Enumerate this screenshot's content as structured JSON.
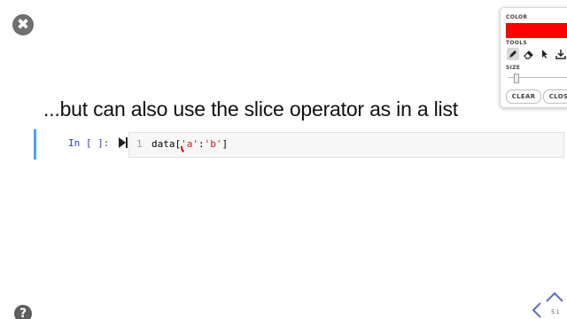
{
  "slide": {
    "heading": "...but can also use the slice operator as in a list",
    "slide_number": "5.1"
  },
  "cell": {
    "prompt": "In [ ]:",
    "line_number": "1",
    "code": {
      "prefix": "data[",
      "str1": "'a'",
      "sep": ":",
      "str2": "'b'",
      "suffix": "]"
    }
  },
  "toolbar": {
    "color_label": "COLOR",
    "selected_color": "#ff0000",
    "tools_label": "TOOLS",
    "tools": [
      "pen-icon",
      "eraser-icon",
      "pointer-icon",
      "download-icon"
    ],
    "active_tool": "pen-icon",
    "size_label": "SIZE",
    "clear_label": "CLEAR",
    "close_label": "CLOSE"
  },
  "controls": {
    "close_symbol": "✖",
    "help_symbol": "?"
  }
}
